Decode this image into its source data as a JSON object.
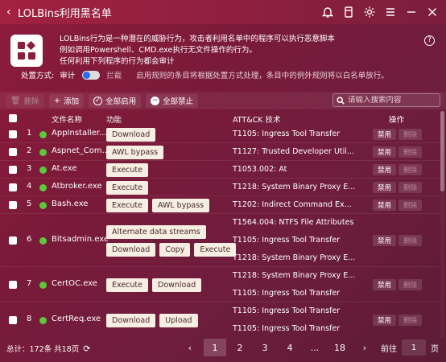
{
  "window": {
    "title": "LOLBins利用黑名单"
  },
  "info": {
    "description_lines": [
      "LOLBins行为是一种潜在的威胁行为，攻击者利用名单中的程序可以执行恶意脚本",
      "例如调用Powershell、CMD.exe执行无文件操作的行为。",
      "任何利用下列程序的行为都会审计"
    ],
    "mode_label": "处置方式:",
    "mode_audit": "审计",
    "mode_block": "拦截",
    "mode_hint": "启用规则的条目将根据处置方式处理，条目中的例外规则将以白名单放行。",
    "help": "?"
  },
  "toolbar": {
    "delete": "删除",
    "add": "添加",
    "enable_all": "全部启用",
    "disable_all": "全部禁止",
    "search_placeholder": "请输入搜索内容"
  },
  "table": {
    "headers": {
      "name": "文件名称",
      "func": "功能",
      "tech": "ATT&CK 技术",
      "ops": "操作"
    },
    "op_disable": "禁用",
    "op_delete": "删除",
    "rows": [
      {
        "no": "1",
        "name": "AppInstaller....",
        "funcs": [
          [
            "Download"
          ]
        ],
        "techs": [
          "T1105: Ingress Tool Transfer"
        ]
      },
      {
        "no": "2",
        "name": "Aspnet_Com...",
        "funcs": [
          [
            "AWL bypass"
          ]
        ],
        "techs": [
          "T1127: Trusted Developer Util..."
        ]
      },
      {
        "no": "3",
        "name": "At.exe",
        "funcs": [
          [
            "Execute"
          ]
        ],
        "techs": [
          "T1053.002: At"
        ]
      },
      {
        "no": "4",
        "name": "Atbroker.exe",
        "funcs": [
          [
            "Execute"
          ]
        ],
        "techs": [
          "T1218: System Binary Proxy E..."
        ]
      },
      {
        "no": "5",
        "name": "Bash.exe",
        "funcs": [
          [
            "Execute",
            "AWL bypass"
          ]
        ],
        "techs": [
          "T1202: Indirect Command Ex..."
        ]
      },
      {
        "no": "6",
        "name": "Bitsadmin.exe",
        "funcs": [
          [
            "Alternate data streams"
          ],
          [
            "Download",
            "Copy",
            "Execute"
          ]
        ],
        "techs": [
          "T1564.004: NTFS File Attributes",
          "T1105: Ingress Tool Transfer",
          "T1218: System Binary Proxy E..."
        ]
      },
      {
        "no": "7",
        "name": "CertOC.exe",
        "funcs": [
          [
            "Execute",
            "Download"
          ]
        ],
        "techs": [
          "T1218: System Binary Proxy E...",
          "T1105: Ingress Tool Transfer"
        ]
      },
      {
        "no": "8",
        "name": "CertReq.exe",
        "funcs": [
          [
            "Download",
            "Upload"
          ]
        ],
        "techs": [
          "T1105: Ingress Tool Transfer",
          "T1105: Ingress Tool Transfer"
        ]
      },
      {
        "no": "",
        "name": "",
        "funcs": [
          [
            "Download"
          ]
        ],
        "techs": [
          "T1105: Ingress Tool Transfer"
        ]
      }
    ]
  },
  "footer": {
    "total": "总计：172条 共18页",
    "pages": [
      "1",
      "2",
      "3",
      "4",
      "...",
      "18"
    ],
    "prev": "‹",
    "next": "›",
    "goto_label": "前往",
    "goto_value": "1",
    "goto_unit": "页"
  }
}
